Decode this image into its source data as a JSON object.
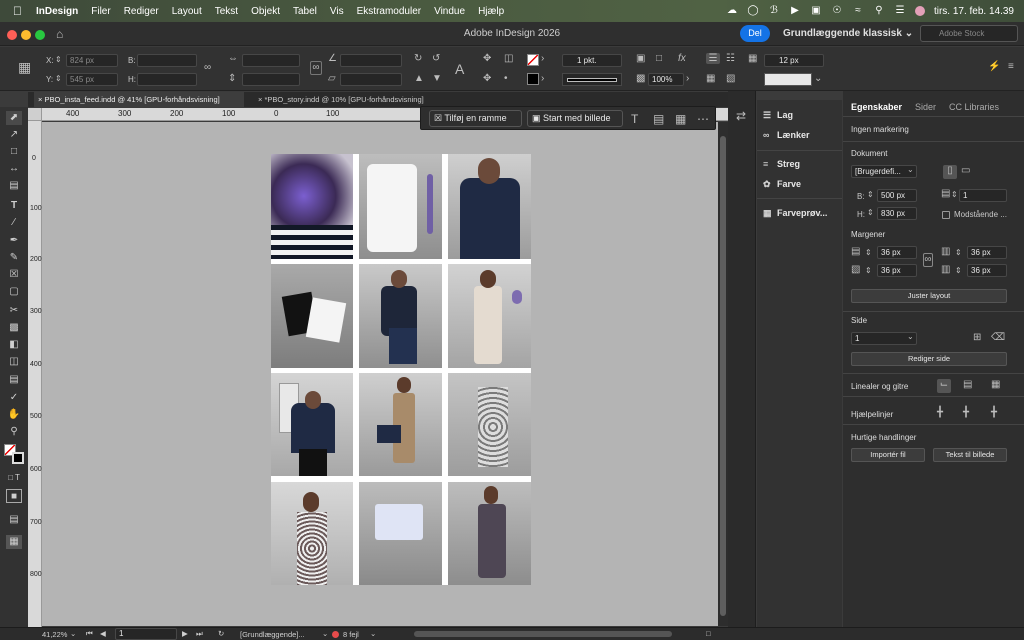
{
  "menubar": {
    "app": "InDesign",
    "items": [
      "Filer",
      "Rediger",
      "Layout",
      "Tekst",
      "Objekt",
      "Tabel",
      "Vis",
      "Ekstramoduler",
      "Vindue",
      "Hjælp"
    ],
    "datetime": "tirs. 17. feb.  14.39"
  },
  "window": {
    "title": "Adobe InDesign 2026",
    "share": "Del",
    "workspace": "Grundlæggende klassisk",
    "stock_placeholder": "Adobe Stock"
  },
  "control": {
    "x_label": "X:",
    "x_value": "824 px",
    "y_label": "Y:",
    "y_value": "545 px",
    "w_label": "B:",
    "h_label": "H:",
    "stroke_weight": "1 pkt.",
    "opacity": "100%",
    "column_gutter": "12 px"
  },
  "tabs": [
    {
      "label": "PBO_insta_feed.indd @ 41% [GPU-forhåndsvisning]"
    },
    {
      "label": "*PBO_story.indd @ 10% [GPU-forhåndsvisning]"
    }
  ],
  "contextbar": {
    "add_frame": "Tilføj en ramme",
    "start_image": "Start med billede"
  },
  "ruler": {
    "h_ticks": [
      "400",
      "300",
      "200",
      "100",
      "0",
      "100"
    ],
    "v_ticks": [
      "0",
      "100",
      "200",
      "300",
      "400",
      "500",
      "600",
      "700",
      "800"
    ]
  },
  "panels": {
    "items": [
      "Lag",
      "Lænker",
      "Streg",
      "Farve",
      "Farveprøv..."
    ]
  },
  "properties": {
    "tabs": [
      "Egenskaber",
      "Sider",
      "CC Libraries"
    ],
    "no_selection": "Ingen markering",
    "document": "Dokument",
    "preset": "[Brugerdefi...",
    "w_label": "B:",
    "width": "500 px",
    "h_label": "H:",
    "height": "830 px",
    "pages": "1",
    "facing": "Modstående ...",
    "margins": "Margener",
    "margin_top": "36 px",
    "margin_bottom": "36 px",
    "margin_left": "36 px",
    "margin_right": "36 px",
    "adjust_layout": "Juster layout",
    "page_section": "Side",
    "page_value": "1",
    "edit_page": "Rediger side",
    "rulers_grids": "Linealer og gitre",
    "guides": "Hjælpelinjer",
    "quick_actions": "Hurtige handlinger",
    "import_file": "Importér fil",
    "text_to_image": "Tekst til billede"
  },
  "status": {
    "zoom": "41,22%",
    "page": "1",
    "preflight_profile": "[Grundlæggende]...",
    "errors": "8 fejl"
  },
  "colors": {
    "accent": "#1473e6",
    "canvas": "#b4b4b4",
    "error": "#e64b4b"
  }
}
